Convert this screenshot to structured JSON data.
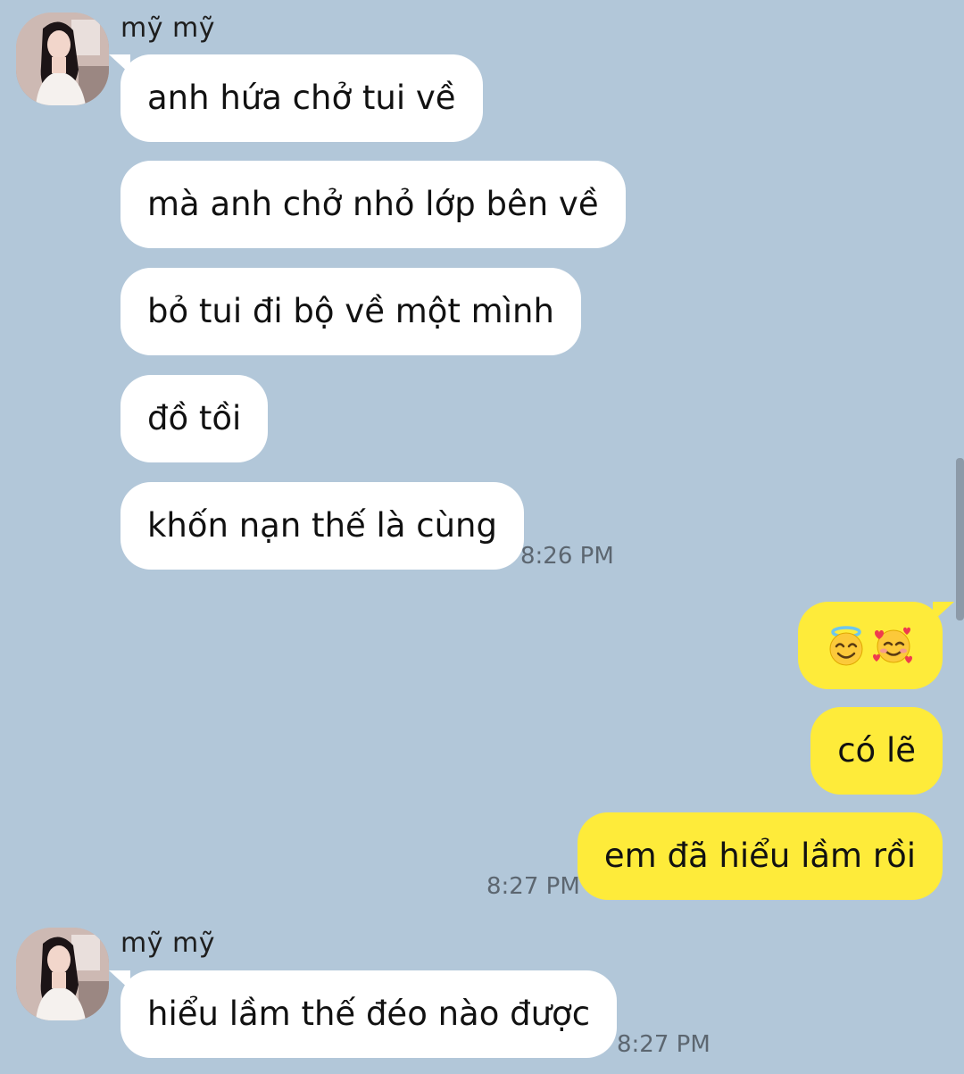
{
  "conversation": {
    "sender_name": "mỹ mỹ",
    "messages": {
      "m1": "anh hứa chở tui về",
      "m2": "mà anh chở nhỏ lớp bên về",
      "m3": "bỏ tui đi bộ về một mình",
      "m4": "đồ tồi",
      "m5": "khốn nạn thế là cùng",
      "o1_emojis": [
        "smiling-face-with-halo",
        "smiling-face-with-hearts"
      ],
      "o2": "có lẽ",
      "o3": "em đã hiểu lầm rồi",
      "m6": "hiểu lầm thế đéo nào được"
    },
    "times": {
      "t1": "8:26 PM",
      "t2": "8:27 PM",
      "t3": "8:27 PM"
    }
  },
  "colors": {
    "background": "#b2c7d9",
    "incoming_bubble": "#ffffff",
    "outgoing_bubble": "#feeb3a",
    "timestamp": "#5c6670"
  }
}
